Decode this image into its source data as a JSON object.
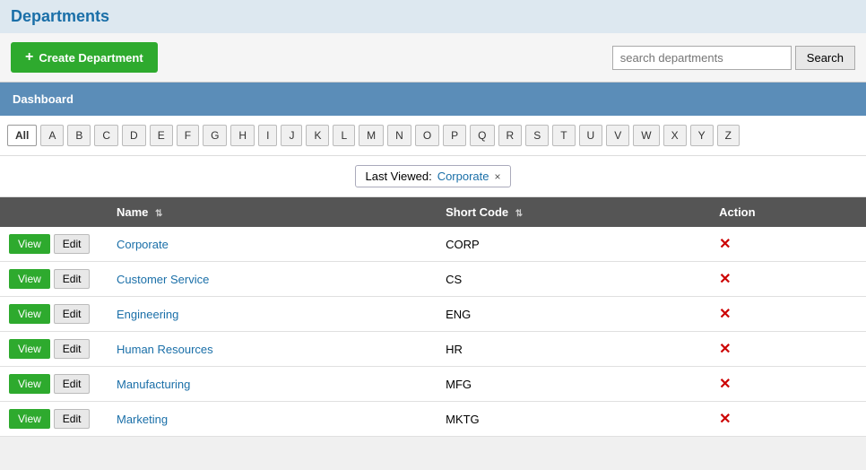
{
  "page": {
    "title": "Departments"
  },
  "toolbar": {
    "create_label": "Create Department",
    "search_placeholder": "search departments",
    "search_button_label": "Search"
  },
  "dashboard": {
    "label": "Dashboard"
  },
  "alphabet": {
    "active": "All",
    "letters": [
      "All",
      "A",
      "B",
      "C",
      "D",
      "E",
      "F",
      "G",
      "H",
      "I",
      "J",
      "K",
      "L",
      "M",
      "N",
      "O",
      "P",
      "Q",
      "R",
      "S",
      "T",
      "U",
      "V",
      "W",
      "X",
      "Y",
      "Z"
    ]
  },
  "last_viewed": {
    "label": "Last Viewed:",
    "name": "Corporate",
    "close": "×"
  },
  "table": {
    "columns": [
      {
        "label": "Name",
        "sortable": true
      },
      {
        "label": "Short Code",
        "sortable": true
      },
      {
        "label": "Action",
        "sortable": false
      }
    ],
    "rows": [
      {
        "name": "Corporate",
        "short_code": "CORP"
      },
      {
        "name": "Customer Service",
        "short_code": "CS"
      },
      {
        "name": "Engineering",
        "short_code": "ENG"
      },
      {
        "name": "Human Resources",
        "short_code": "HR"
      },
      {
        "name": "Manufacturing",
        "short_code": "MFG"
      },
      {
        "name": "Marketing",
        "short_code": "MKTG"
      }
    ],
    "view_label": "View",
    "edit_label": "Edit",
    "delete_symbol": "✕"
  }
}
